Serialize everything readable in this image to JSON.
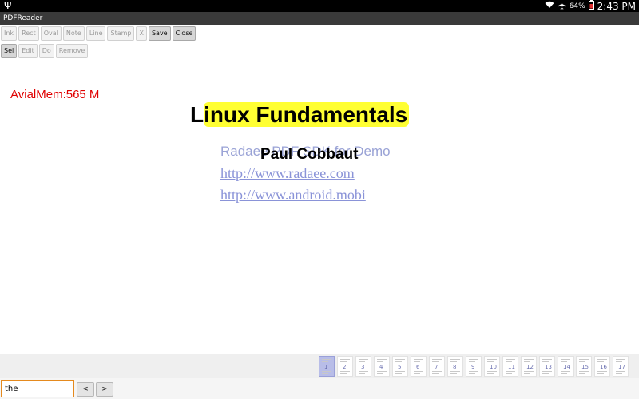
{
  "status_bar": {
    "usb_icon": "usb-icon",
    "wifi_icon": "wifi-icon",
    "airplane_icon": "airplane-icon",
    "battery_percent": "64%",
    "battery_icon": "battery-icon",
    "time": "2:43 PM"
  },
  "app": {
    "title": "PDFReader"
  },
  "toolbar": {
    "row1": [
      {
        "label": "Ink",
        "active": false
      },
      {
        "label": "Rect",
        "active": false
      },
      {
        "label": "Oval",
        "active": false
      },
      {
        "label": "Note",
        "active": false
      },
      {
        "label": "Line",
        "active": false
      },
      {
        "label": "Stamp",
        "active": false
      },
      {
        "label": "X",
        "active": false
      },
      {
        "label": "Save",
        "active": true
      },
      {
        "label": "Close",
        "active": true
      }
    ],
    "row2": [
      {
        "label": "Sel",
        "active": true
      },
      {
        "label": "Edit",
        "active": false
      },
      {
        "label": "Do",
        "active": false
      },
      {
        "label": "Remove",
        "active": false
      }
    ]
  },
  "memory_readout": "AvialMem:565 M",
  "document": {
    "title_first_letter": "L",
    "title_highlighted": "inux Fundamentals",
    "watermark_text": "Radaee PDF SDK for Demo",
    "author": "Paul Cobbaut",
    "link1": "http://www.radaee.com",
    "link2": "http://www.android.mobi"
  },
  "thumbnails": {
    "selected_page": 1,
    "pages": [
      1,
      2,
      3,
      4,
      5,
      6,
      7,
      8,
      9,
      10,
      11,
      12,
      13,
      14,
      15,
      16,
      17
    ]
  },
  "search": {
    "value": "the",
    "prev_label": "<",
    "next_label": ">"
  }
}
